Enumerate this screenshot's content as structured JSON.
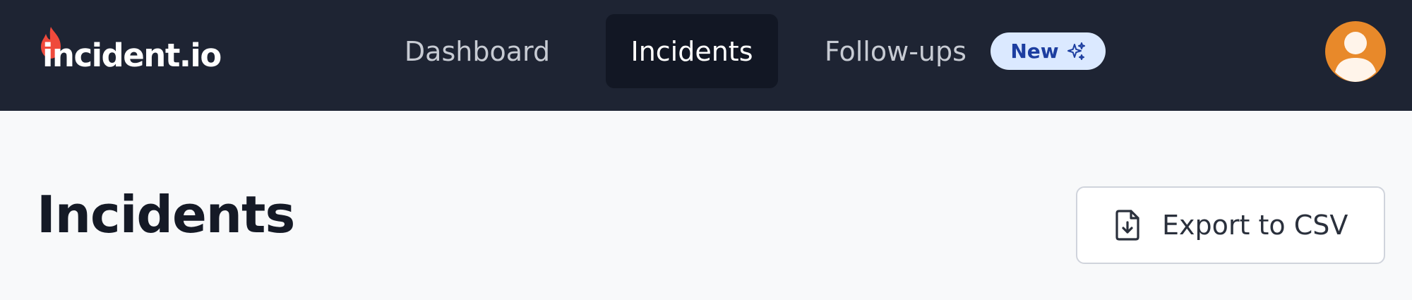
{
  "app": {
    "logo_text": "incident.io",
    "colors": {
      "topbar": "#1e2433",
      "active_tab": "#121724",
      "badge_bg": "#dbe9ff",
      "badge_text": "#1d3ea0",
      "flame": "#ef4a3c",
      "avatar": "#e8892a",
      "page_bg": "#f8f9fa"
    }
  },
  "nav": {
    "items": [
      {
        "label": "Dashboard",
        "active": false
      },
      {
        "label": "Incidents",
        "active": true
      },
      {
        "label": "Follow-ups",
        "active": false,
        "badge": "New",
        "badge_icon": "sparkles-icon"
      }
    ]
  },
  "user": {
    "avatar_icon": "user-avatar-icon"
  },
  "main": {
    "title": "Incidents",
    "export_button": {
      "label": "Export to CSV",
      "icon": "file-download-icon"
    }
  }
}
